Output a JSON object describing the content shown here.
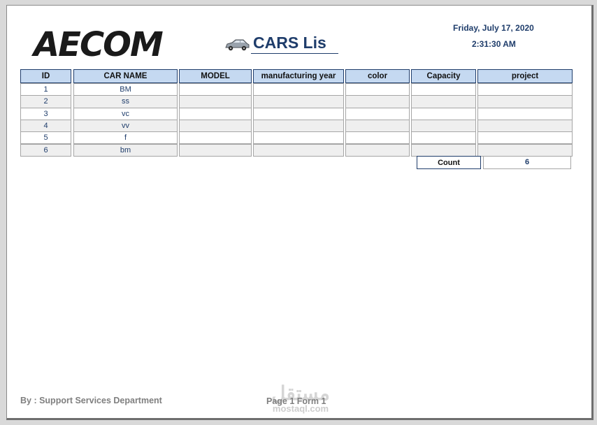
{
  "header": {
    "logo_text": "AECOM",
    "car_icon": "car-icon",
    "title": "CARS Lis",
    "date": "Friday, July 17, 2020",
    "time": "2:31:30 AM"
  },
  "table": {
    "columns": [
      "ID",
      "CAR NAME",
      "MODEL",
      "manufacturing year",
      "color",
      "Capacity",
      "project"
    ],
    "rows": [
      [
        "1",
        "BM",
        "",
        "",
        "",
        "",
        ""
      ],
      [
        "2",
        "ss",
        "",
        "",
        "",
        "",
        ""
      ],
      [
        "3",
        "vc",
        "",
        "",
        "",
        "",
        ""
      ],
      [
        "4",
        "vv",
        "",
        "",
        "",
        "",
        ""
      ],
      [
        "5",
        "f",
        "",
        "",
        "",
        "",
        ""
      ],
      [
        "6",
        "bm",
        "",
        "",
        "",
        "",
        ""
      ]
    ]
  },
  "summary": {
    "count_label": "Count",
    "count_value": "6"
  },
  "footer": {
    "by_text": "By : Support Services Department",
    "page_text": "Page 1 Form 1"
  },
  "watermark": {
    "arabic": "مستقل",
    "latin": "mostaql.com"
  },
  "colors": {
    "header_fill": "#c5d9f1",
    "accent": "#1f3d6b",
    "alt_row": "#efefef"
  }
}
